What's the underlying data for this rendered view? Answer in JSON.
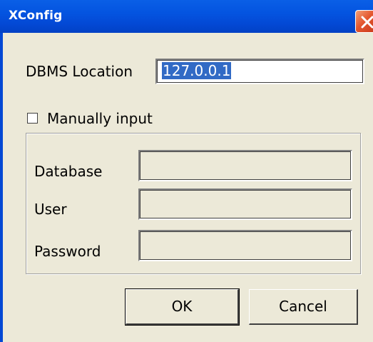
{
  "window": {
    "title": "XConfig",
    "title_bar_color": "#0454e0"
  },
  "dbms": {
    "label": "DBMS Location",
    "value": "127.0.0.1"
  },
  "manual": {
    "checkbox_label": "Manually input",
    "checked": false
  },
  "fields": {
    "database_label": "Database",
    "user_label": "User",
    "password_label": "Password"
  },
  "buttons": {
    "ok": "OK",
    "cancel": "Cancel"
  },
  "icons": {
    "close": "close-icon"
  }
}
